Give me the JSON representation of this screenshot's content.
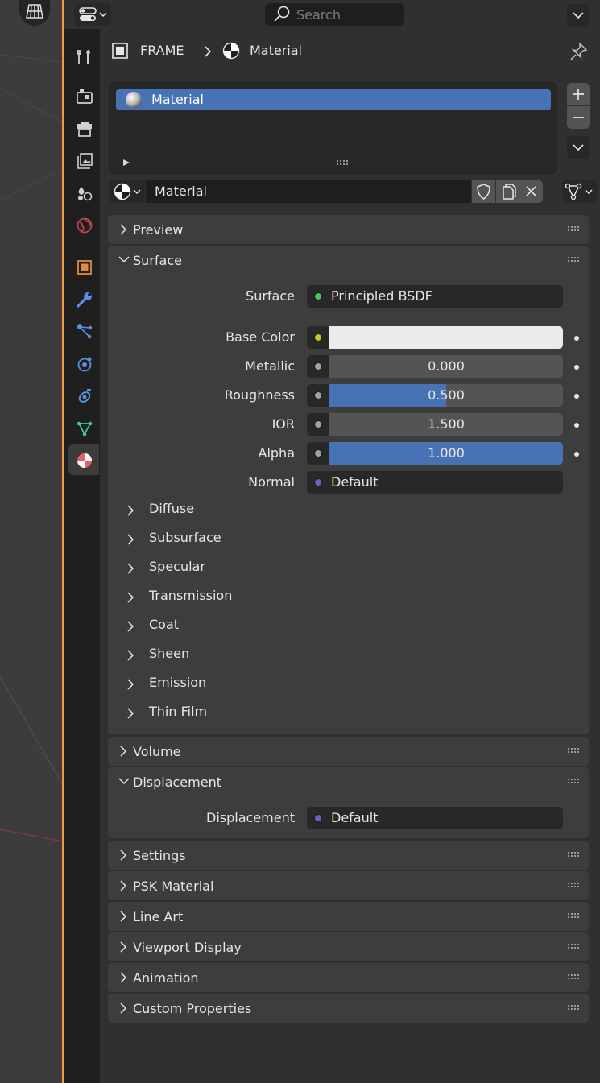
{
  "header": {
    "search_placeholder": "Search"
  },
  "breadcrumb": {
    "object": "FRAME",
    "material": "Material"
  },
  "material_slots": {
    "items": [
      {
        "label": "Material",
        "selected": true
      }
    ]
  },
  "material_selector": {
    "name": "Material"
  },
  "sections": {
    "preview": "Preview",
    "surface": "Surface",
    "volume": "Volume",
    "displacement": "Displacement",
    "settings": "Settings",
    "psk_material": "PSK Material",
    "line_art": "Line Art",
    "viewport_display": "Viewport Display",
    "animation": "Animation",
    "custom_properties": "Custom Properties"
  },
  "surface": {
    "surface_label": "Surface",
    "surface_value": "Principled BSDF",
    "base_color_label": "Base Color",
    "base_color_value": "#ebebeb",
    "metallic_label": "Metallic",
    "metallic_value": "0.000",
    "metallic_fraction": 0.0,
    "roughness_label": "Roughness",
    "roughness_value": "0.500",
    "roughness_fraction": 0.5,
    "ior_label": "IOR",
    "ior_value": "1.500",
    "alpha_label": "Alpha",
    "alpha_value": "1.000",
    "alpha_fraction": 1.0,
    "normal_label": "Normal",
    "normal_value": "Default",
    "subpanels": [
      "Diffuse",
      "Subsurface",
      "Specular",
      "Transmission",
      "Coat",
      "Sheen",
      "Emission",
      "Thin Film"
    ]
  },
  "displacement": {
    "label": "Displacement",
    "value": "Default"
  },
  "colors": {
    "accent": "#4772b3",
    "active_border": "#f59a3c",
    "shader_socket": "#4fc35b",
    "color_socket": "#c7c729",
    "float_socket": "#a1a1a1",
    "vector_socket": "#6363c7"
  },
  "icons": {
    "tabs": [
      "tool-icon",
      "render-icon",
      "output-icon",
      "view-layer-icon",
      "scene-icon",
      "world-icon",
      "object-icon",
      "modifier-icon",
      "particles-icon",
      "physics-icon",
      "constraints-icon",
      "data-icon",
      "material-icon"
    ]
  }
}
